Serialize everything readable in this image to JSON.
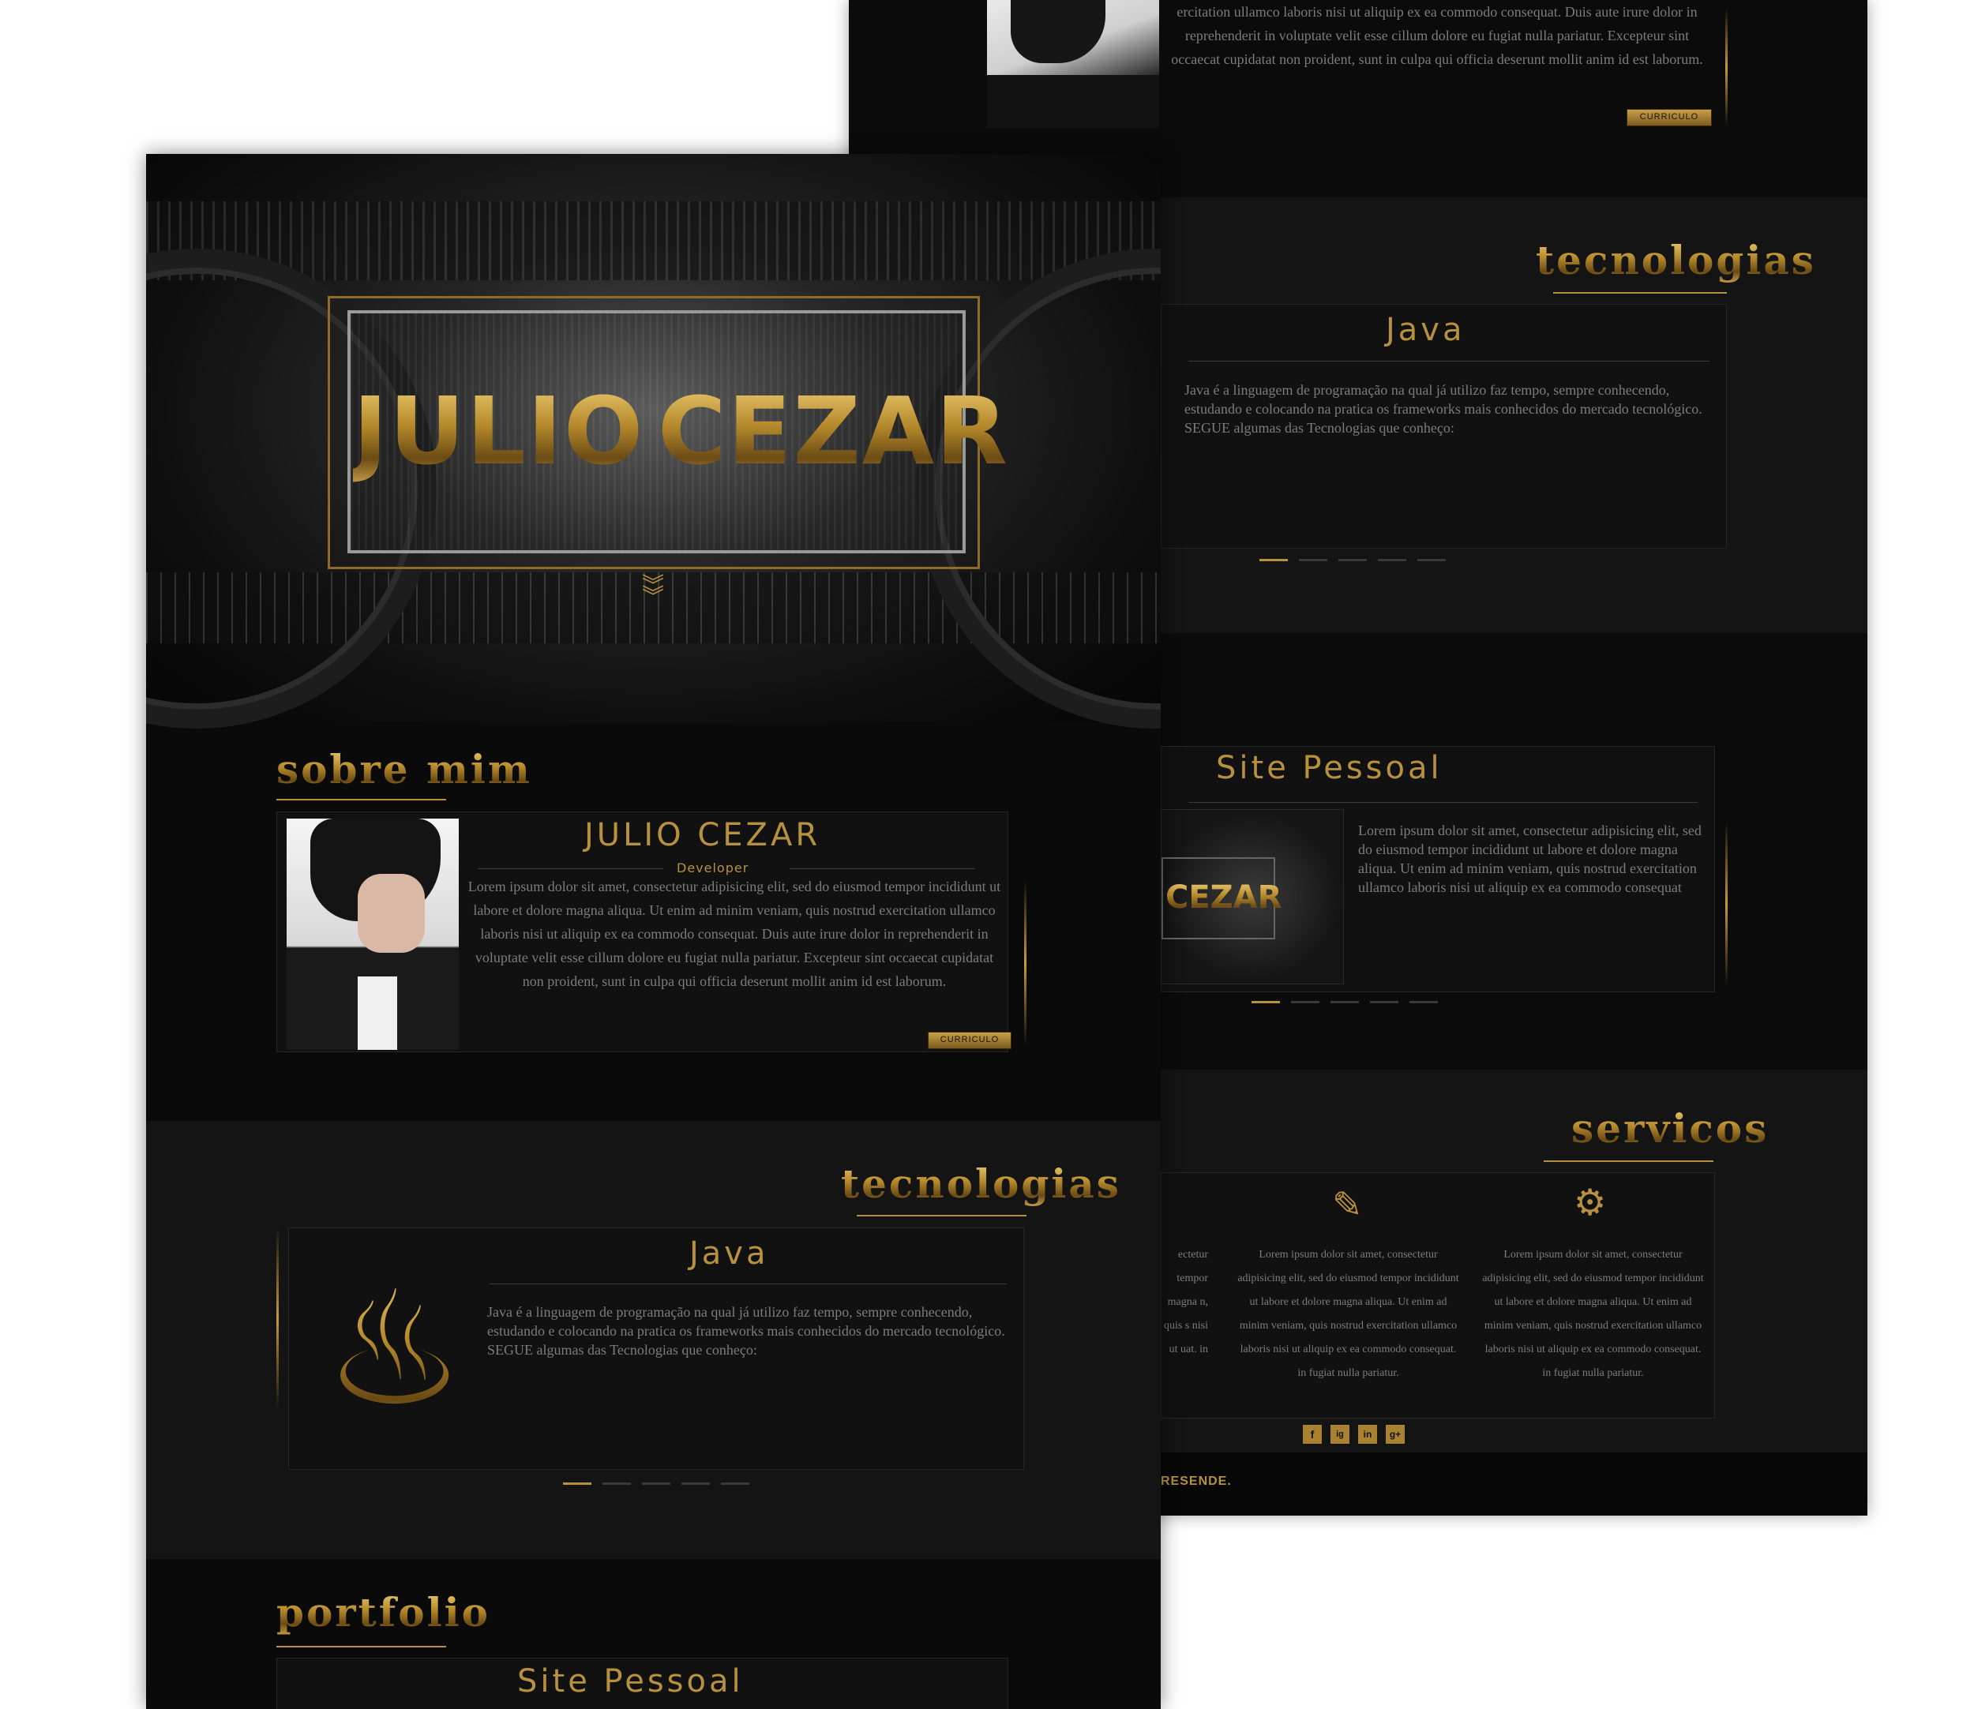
{
  "hero": {
    "name_first": "JULIO",
    "name_last": "CEZAR"
  },
  "sections": {
    "sobre_heading": "sobre mim",
    "tec_heading": "tecnologias",
    "portfolio_heading": "portfolio",
    "servicos_heading": "servicos"
  },
  "about": {
    "name": "JULIO CEZAR",
    "role": "Developer",
    "text": "Lorem ipsum dolor sit amet, consectetur adipisicing elit, sed do eiusmod tempor incididunt ut labore et dolore magna aliqua. Ut enim ad minim veniam, quis nostrud exercitation ullamco laboris nisi ut aliquip ex ea commodo consequat. Duis aute irure dolor in reprehenderit in voluptate velit esse cillum dolore eu fugiat nulla pariatur. Excepteur sint occaecat cupidatat non proident, sunt in culpa qui officia deserunt mollit anim id est laborum.",
    "text_back": "ercitation ullamco laboris nisi ut aliquip ex ea commodo consequat. Duis aute irure dolor in reprehenderit in voluptate velit esse cillum dolore eu fugiat nulla pariatur. Excepteur sint occaecat cupidatat non proident, sunt in culpa qui officia deserunt mollit anim id est laborum.",
    "button": "CURRICULO"
  },
  "tech": {
    "title": "Java",
    "text": "Java é a linguagem de programação na qual já utilizo faz tempo, sempre conhecendo, estudando e colocando na pratica os frameworks mais conhecidos do mercado tecnológico. SEGUE algumas das Tecnologias que conheço:"
  },
  "portfolio": {
    "title": "Site Pessoal",
    "text": "Lorem ipsum dolor sit amet, consectetur adipisicing elit, sed do eiusmod tempor incididunt ut labore et dolore magna aliqua. Ut enim ad minim veniam, quis nostrud exercitation ullamco laboris nisi ut aliquip ex ea commodo consequat",
    "thumb_text": "CEZAR"
  },
  "services": {
    "col_text": "Lorem ipsum dolor sit amet, consectetur adipisicing elit, sed do eiusmod tempor incididunt ut labore et dolore magna aliqua. Ut enim ad minim veniam, quis nostrud exercitation ullamco laboris nisi ut aliquip ex ea commodo consequat. in fugiat nulla pariatur.",
    "partial_col": "ectetur tempor magna n, quis s nisi ut uat. in"
  },
  "social": [
    "f",
    "ig",
    "in",
    "g+"
  ],
  "footer": {
    "text": "RESENDE."
  },
  "colors": {
    "gold": "#b8913f",
    "bg_dark": "#0a0a0a",
    "bg_band": "#121212"
  }
}
